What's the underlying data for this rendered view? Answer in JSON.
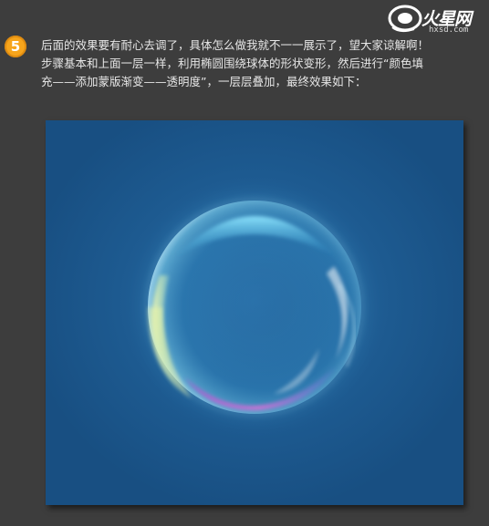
{
  "step": {
    "number": "5"
  },
  "description": {
    "line1": "后面的效果要有耐心去调了，具体怎么做我就不一一展示了，望大家谅解啊！",
    "line2": "步骤基本和上面一层一样，利用椭圆围绕球体的形状变形，然后进行“颜色填",
    "line3": "充——添加蒙版渐变——透明度”，一层层叠加，最终效果如下："
  },
  "logo": {
    "title": "火星网",
    "subtitle": "hxsd.com"
  },
  "colors": {
    "background": "#3d3d3d",
    "canvas": "#1b5589",
    "badge": "#f7a51c"
  }
}
